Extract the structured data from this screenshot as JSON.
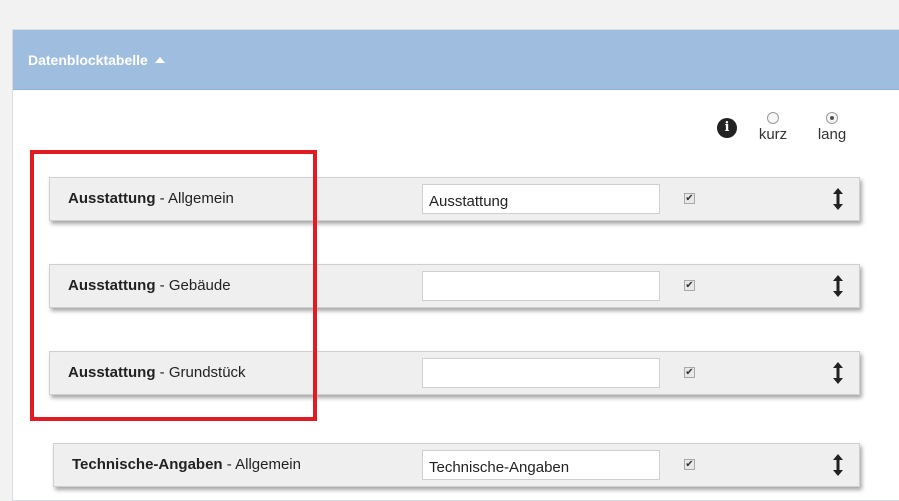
{
  "panel": {
    "title": "Datenblocktabelle",
    "caret_icon": "caret-up-icon"
  },
  "options": {
    "info_icon": "info-icon",
    "info_glyph": "i",
    "radio_short_label": "kurz",
    "radio_long_label": "lang",
    "selected": "lang"
  },
  "rows": [
    {
      "bold": "Ausstattung",
      "sep": " - ",
      "suffix": "Allgemein",
      "value": "Ausstattung",
      "checked": true,
      "check_glyph": "✔"
    },
    {
      "bold": "Ausstattung",
      "sep": " - ",
      "suffix": "Gebäude",
      "value": "",
      "checked": true,
      "check_glyph": "✔"
    },
    {
      "bold": "Ausstattung",
      "sep": " - ",
      "suffix": "Grundstück",
      "value": "",
      "checked": true,
      "check_glyph": "✔"
    },
    {
      "bold": "Technische-Angaben",
      "sep": " - ",
      "suffix": "Allgemein",
      "value": "Technische-Angaben",
      "checked": true,
      "check_glyph": "✔"
    }
  ],
  "colors": {
    "header_bg": "#9fbedf",
    "highlight_border": "#e21b23",
    "row_bg": "#efefef"
  }
}
